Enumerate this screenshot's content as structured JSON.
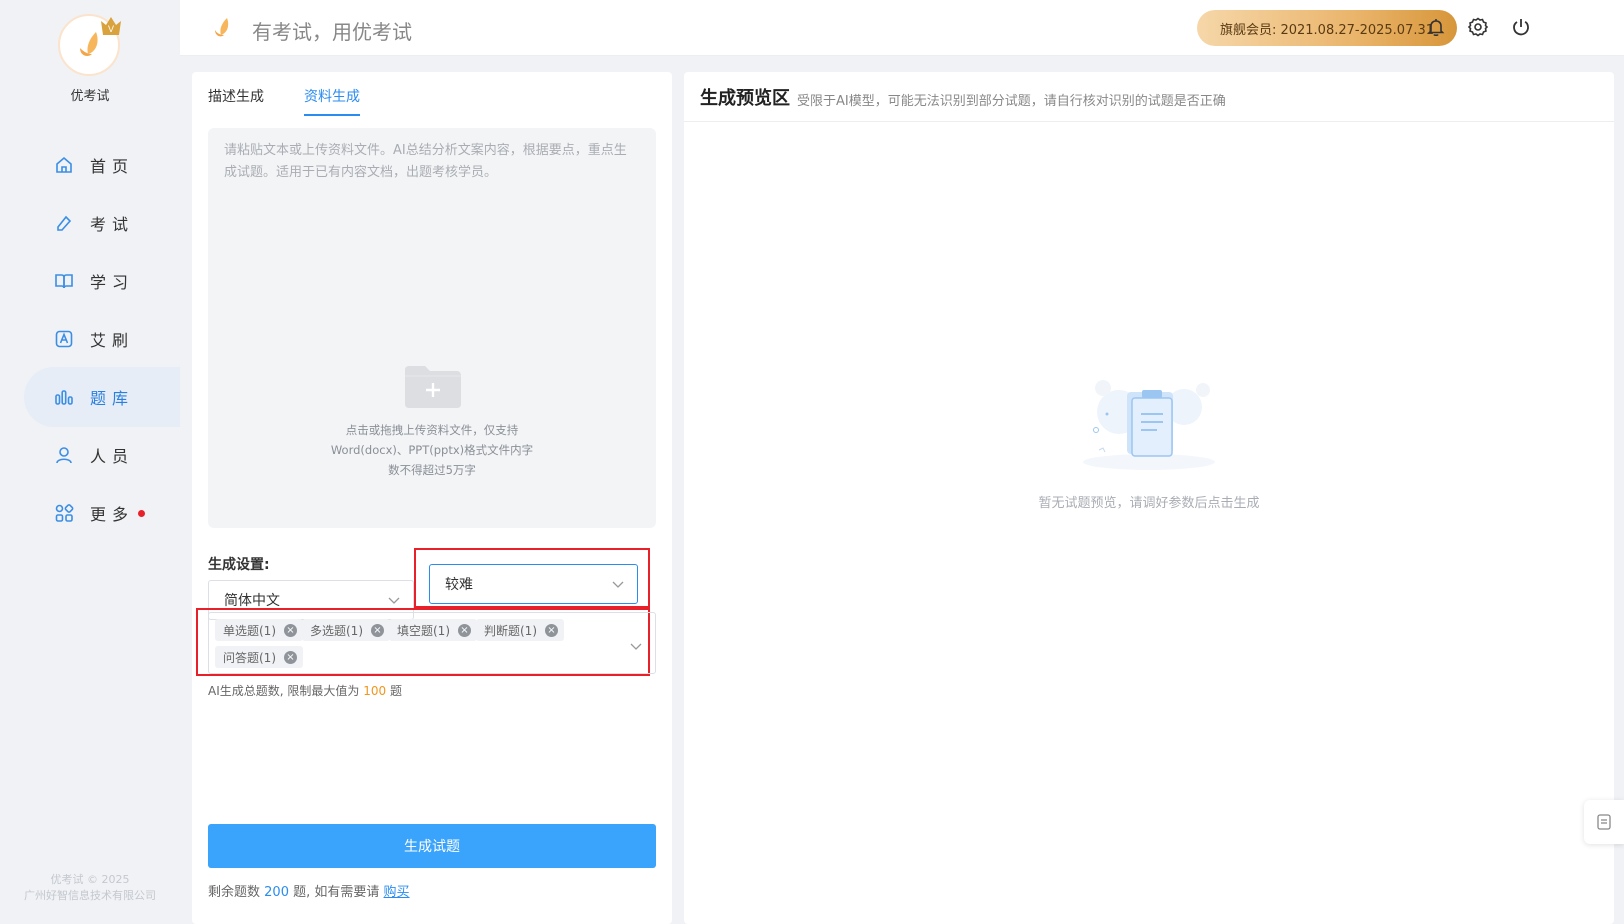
{
  "brand": {
    "name": "优考试",
    "slogan": "有考试，用优考试",
    "vip_letter": "V",
    "footer_line1": "优考试 © 2025",
    "footer_line2": "广州好智信息技术有限公司"
  },
  "membership": {
    "text": "旗舰会员: 2021.08.27-2025.07.31"
  },
  "sidebar": {
    "items": [
      {
        "label": "首页",
        "icon": "home-icon"
      },
      {
        "label": "考试",
        "icon": "edit-icon"
      },
      {
        "label": "学习",
        "icon": "book-icon"
      },
      {
        "label": "艾刷",
        "icon": "letter-a-icon"
      },
      {
        "label": "题库",
        "icon": "bar-chart-icon",
        "active": true
      },
      {
        "label": "人员",
        "icon": "user-icon"
      },
      {
        "label": "更多",
        "icon": "apps-icon",
        "has_dot": true
      }
    ]
  },
  "tabs": {
    "describe": "描述生成",
    "material": "资料生成"
  },
  "upload": {
    "hint": "请粘贴文本或上传资料文件。AI总结分析文案内容，根据要点，重点生成试题。适用于已有内容文档，出题考核学员。",
    "desc_line1": "点击或拖拽上传资料文件，仅支持",
    "desc_line2": "Word(docx)、PPT(pptx)格式文件内字",
    "desc_line3": "数不得超过5万字"
  },
  "settings": {
    "label": "生成设置:",
    "language": "简体中文",
    "difficulty": "较难",
    "question_types": [
      "单选题(1)",
      "多选题(1)",
      "填空题(1)",
      "判断题(1)",
      "问答题(1)"
    ],
    "limit_prefix": "AI生成总题数, 限制最大值为",
    "limit_value": "100",
    "limit_suffix": "题"
  },
  "actions": {
    "generate": "生成试题",
    "remain_prefix": "剩余题数",
    "remain_value": "200",
    "remain_mid": "题, 如有需要请",
    "buy": "购买"
  },
  "preview": {
    "title": "生成预览区",
    "subtitle": "受限于AI模型，可能无法识别到部分试题，请自行核对识别的试题是否正确",
    "empty": "暂无试题预览，请调好参数后点击生成"
  },
  "colors": {
    "accent": "#2b8cf0",
    "button": "#3aa3fb",
    "highlight_frame": "#e8202a",
    "gold": "#eab56c"
  }
}
